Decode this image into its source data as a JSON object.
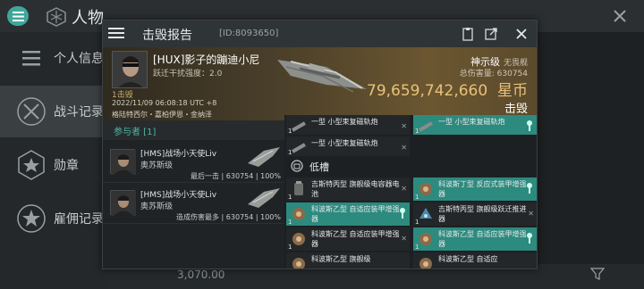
{
  "background": {
    "title": "人物",
    "sidebar": [
      {
        "label": "个人信息"
      },
      {
        "label": "战斗记录"
      },
      {
        "label": "勋章"
      },
      {
        "label": "雇佣记录"
      }
    ],
    "bottom_value": "3,070.00"
  },
  "modal": {
    "title": "击毁报告",
    "id_label": "[ID:8093650]"
  },
  "victim": {
    "pilot": "[HUX]影子的蹦迪小尼",
    "security": "跃迁干扰强度：2.0",
    "corp_tag": "1击毁",
    "timestamp": "2022/11/09 06:08:18 UTC +8",
    "location": "格陆特西尔・嘉柏伊恩・金纳泽",
    "ship_class": "神示级",
    "ship_class_sub": "无畏舰",
    "total_damage": "总伤害量: 630754",
    "isk_value": "79,659,742,660",
    "isk_unit": "星币",
    "result": "击毁"
  },
  "participants": {
    "header": "参与者 [1]",
    "rows": [
      {
        "name": "[HMS]战场小天使Liv",
        "corp": "奥苏斯级",
        "role": "最后一击",
        "damage": "630754",
        "percent": "100%"
      },
      {
        "name": "[HMS]战场小天使Liv",
        "corp": "奥苏斯级",
        "role": "造成伤害最多",
        "damage": "630754",
        "percent": "100%"
      }
    ]
  },
  "fitting": {
    "top_slots": [
      {
        "name": "一型 小型束复磁轨炮",
        "qty": "1"
      },
      {
        "name": "一型 小型束复磁轨炮",
        "qty": "1"
      },
      {
        "name": "一型 小型束复磁轨炮",
        "qty": "1"
      }
    ],
    "low_label": "低槽",
    "low_slots": [
      {
        "name": "吉斯特丙型 旗舰级电容器电池",
        "qty": "1",
        "highlight": false
      },
      {
        "name": "科波斯丁型 反应式装甲增强器",
        "qty": "1",
        "highlight": true
      },
      {
        "name": "科波斯乙型 自适应装甲增强器",
        "qty": "1",
        "highlight": true
      },
      {
        "name": "吉斯特丙型 旗舰级跃迁推进器",
        "qty": "1",
        "highlight": false
      },
      {
        "name": "科波斯乙型 自适应装甲增强器",
        "qty": "1",
        "highlight": false
      },
      {
        "name": "科波斯乙型 自适应装甲增强器",
        "qty": "1",
        "highlight": true
      },
      {
        "name": "科波斯乙型 旗舰级",
        "qty": "1",
        "highlight": false
      },
      {
        "name": "科波斯乙型 自适应",
        "qty": "1",
        "highlight": false
      }
    ]
  }
}
